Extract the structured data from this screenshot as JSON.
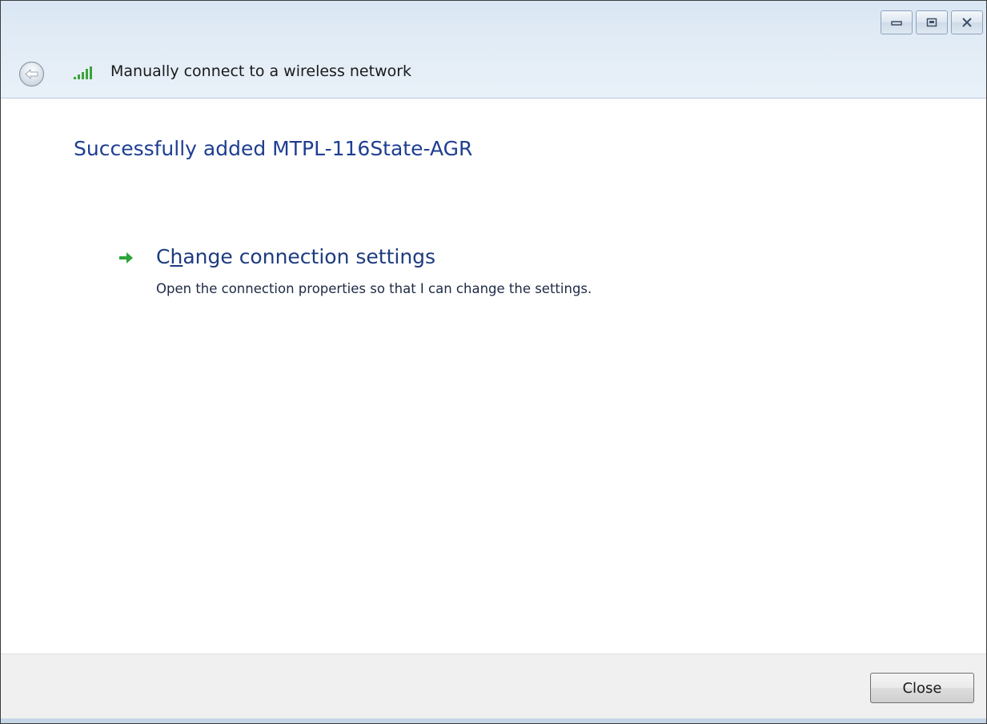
{
  "window": {
    "title": "Manually connect to a wireless network",
    "caption_buttons": [
      "minimize-icon",
      "restore-icon",
      "close-icon"
    ]
  },
  "content": {
    "heading": "Successfully added MTPL-116State-AGR",
    "command": {
      "title_pre": "C",
      "title_access_key": "h",
      "title_post": "ange connection settings",
      "description": "Open the connection properties so that I can change the settings."
    }
  },
  "footer": {
    "close_label": "Close"
  },
  "colors": {
    "heading": "#1e3e91",
    "command_title": "#1d3c7e",
    "arrow": "#2aa53a",
    "signal": "#3aa43a"
  }
}
